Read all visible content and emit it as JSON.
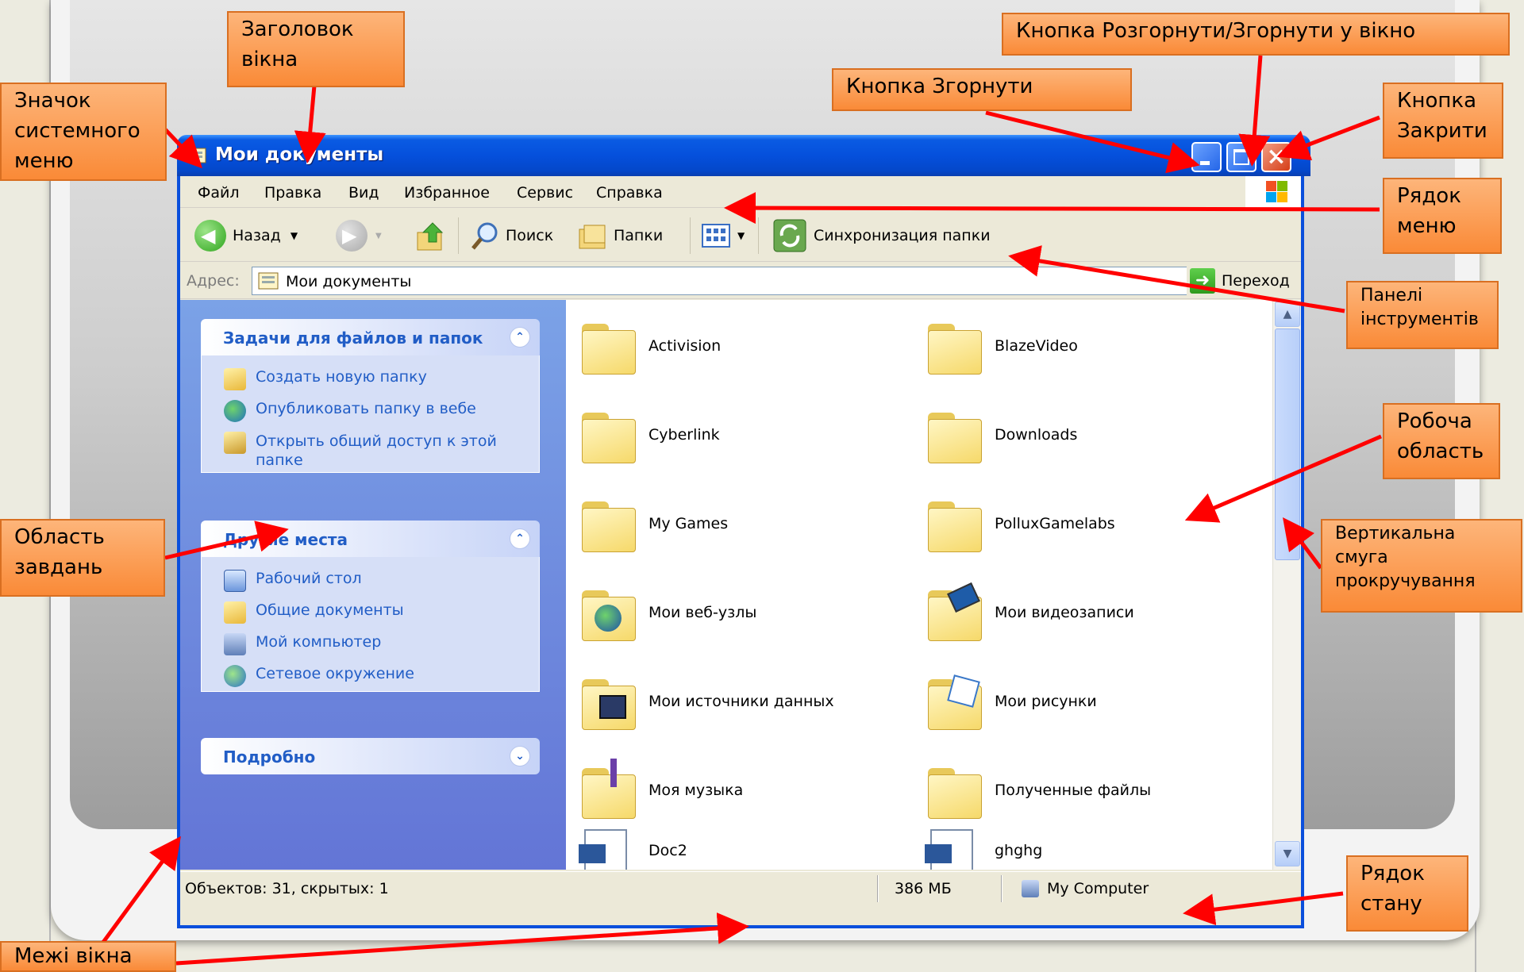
{
  "window": {
    "title": "Мои документы",
    "menu": [
      "Файл",
      "Правка",
      "Вид",
      "Избранное",
      "Сервис",
      "Справка"
    ],
    "toolbar": {
      "back": "Назад",
      "search": "Поиск",
      "folders": "Папки",
      "sync": "Синхронизация папки"
    },
    "address": {
      "label": "Адрес:",
      "value": "Мои документы",
      "go": "Переход"
    },
    "tasks": {
      "file_tasks": {
        "title": "Задачи для файлов и папок",
        "items": [
          "Создать новую папку",
          "Опубликовать папку в вебе",
          "Открыть общий доступ к этой папке"
        ]
      },
      "other_places": {
        "title": "Другие места",
        "items": [
          "Рабочий стол",
          "Общие документы",
          "Мой компьютер",
          "Сетевое окружение"
        ]
      },
      "details": {
        "title": "Подробно"
      }
    },
    "items": [
      "Activision",
      "BlazeVideo",
      "Cyberlink",
      "Downloads",
      "My Games",
      "PolluxGamelabs",
      "Мои веб-узлы",
      "Мои видеозаписи",
      "Мои источники данных",
      "Мои рисунки",
      "Моя музыка",
      "Полученные файлы",
      "Doc2",
      "ghghg"
    ],
    "status": {
      "objects": "Объектов: 31, скрытых: 1",
      "size": "386 МБ",
      "location": "My Computer"
    }
  },
  "callouts": {
    "title": "Заголовок вікна",
    "sysmenu": "Значок системного меню",
    "maximize": "Кнопка Розгорнути/Згорнути у вікно",
    "minimize": "Кнопка Згорнути",
    "close": "Кнопка Закрити",
    "menubar": "Рядок меню",
    "toolbars": "Панелі інструментів",
    "workarea": "Робоча область",
    "taskarea": "Область завдань",
    "scrollbar": "Вертикальна смуга прокручування",
    "statusbar": "Рядок стану",
    "borders": "Межі вікна"
  },
  "colors": {
    "titlebar": "#0550dc",
    "callout": "#fa8a37",
    "arrow": "#ff0000",
    "taskpane": "#6375d6",
    "link": "#215dc6"
  }
}
